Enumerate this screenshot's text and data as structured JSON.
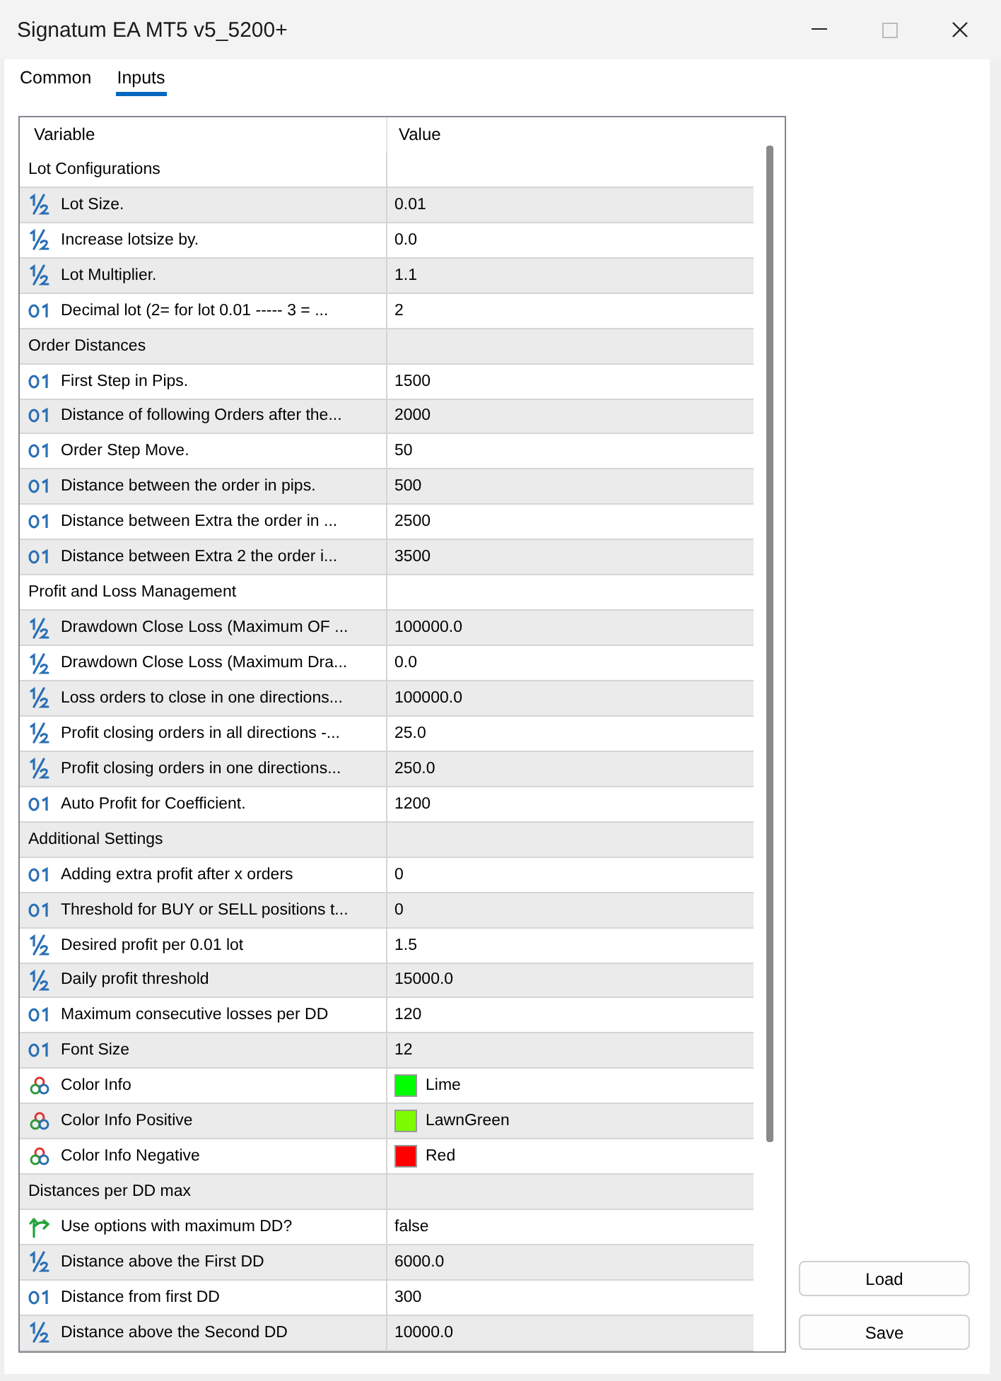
{
  "window": {
    "title": "Signatum EA MT5 v5_5200+"
  },
  "tabs": [
    {
      "label": "Common",
      "selected": false
    },
    {
      "label": "Inputs",
      "selected": true
    }
  ],
  "table": {
    "columns": [
      "Variable",
      "Value"
    ],
    "rows": [
      {
        "kind": "group",
        "variable": "Lot Configurations"
      },
      {
        "kind": "double",
        "variable": "Lot Size.",
        "value": "0.01"
      },
      {
        "kind": "double",
        "variable": "Increase lotsize by.",
        "value": "0.0"
      },
      {
        "kind": "double",
        "variable": "Lot Multiplier.",
        "value": "1.1"
      },
      {
        "kind": "int",
        "variable": "Decimal lot (2= for lot 0.01 ----- 3 = ...",
        "value": "2"
      },
      {
        "kind": "group",
        "variable": "Order Distances"
      },
      {
        "kind": "int",
        "variable": "First Step in Pips.",
        "value": "1500"
      },
      {
        "kind": "int",
        "variable": "Distance of following Orders after the...",
        "value": "2000"
      },
      {
        "kind": "int",
        "variable": "Order Step Move.",
        "value": "50"
      },
      {
        "kind": "int",
        "variable": "Distance between the order in pips.",
        "value": "500"
      },
      {
        "kind": "int",
        "variable": "Distance between Extra the order in ...",
        "value": "2500"
      },
      {
        "kind": "int",
        "variable": "Distance between Extra 2 the order i...",
        "value": "3500"
      },
      {
        "kind": "group",
        "variable": "Profit and Loss Management"
      },
      {
        "kind": "double",
        "variable": "Drawdown Close Loss (Maximum OF ...",
        "value": "100000.0"
      },
      {
        "kind": "double",
        "variable": "Drawdown Close Loss (Maximum Dra...",
        "value": "0.0"
      },
      {
        "kind": "double",
        "variable": "Loss orders to close in one directions...",
        "value": "100000.0"
      },
      {
        "kind": "double",
        "variable": "Profit closing orders in all directions -...",
        "value": "25.0"
      },
      {
        "kind": "double",
        "variable": "Profit closing orders in one directions...",
        "value": "250.0"
      },
      {
        "kind": "int",
        "variable": "Auto Profit for Coefficient.",
        "value": "1200"
      },
      {
        "kind": "group",
        "variable": "Additional Settings"
      },
      {
        "kind": "int",
        "variable": "Adding extra profit after x orders",
        "value": "0"
      },
      {
        "kind": "int",
        "variable": "Threshold for BUY or SELL positions t...",
        "value": "0"
      },
      {
        "kind": "double",
        "variable": "Desired profit per 0.01 lot",
        "value": "1.5"
      },
      {
        "kind": "double",
        "variable": "Daily profit threshold",
        "value": "15000.0"
      },
      {
        "kind": "int",
        "variable": "Maximum consecutive losses per DD",
        "value": "120"
      },
      {
        "kind": "int",
        "variable": "Font Size",
        "value": "12"
      },
      {
        "kind": "color",
        "variable": "Color Info",
        "value": "Lime",
        "color": "#00ff00"
      },
      {
        "kind": "color",
        "variable": "Color Info Positive",
        "value": "LawnGreen",
        "color": "#7cfc00"
      },
      {
        "kind": "color",
        "variable": "Color Info Negative",
        "value": "Red",
        "color": "#ff0000"
      },
      {
        "kind": "group",
        "variable": "Distances per DD max"
      },
      {
        "kind": "bool",
        "variable": "Use options with maximum DD?",
        "value": "false"
      },
      {
        "kind": "double",
        "variable": "Distance above the First DD",
        "value": "6000.0"
      },
      {
        "kind": "int",
        "variable": "Distance from first DD",
        "value": "300"
      },
      {
        "kind": "double",
        "variable": "Distance above the Second DD",
        "value": "10000.0"
      }
    ]
  },
  "buttons": [
    {
      "label": "Load"
    },
    {
      "label": "Save"
    }
  ]
}
